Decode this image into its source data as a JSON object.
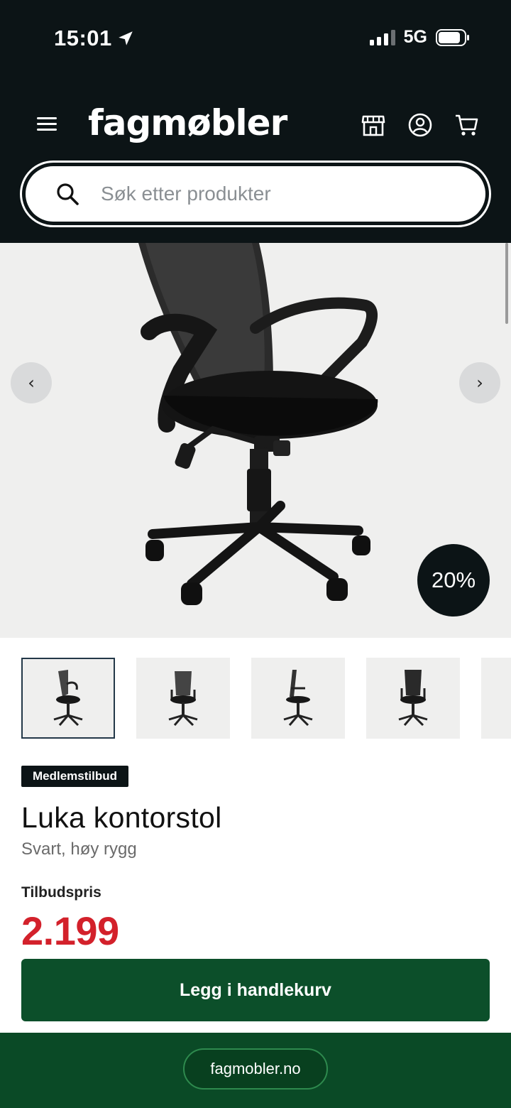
{
  "status_bar": {
    "time": "15:01",
    "network": "5G"
  },
  "header": {
    "logo": "fagmøbler",
    "icons": [
      "menu-icon",
      "store-icon",
      "account-icon",
      "cart-icon"
    ]
  },
  "search": {
    "placeholder": "Søk etter produkter"
  },
  "gallery": {
    "discount": "20%",
    "thumbnail_count": 5,
    "active_index": 0
  },
  "product": {
    "badge": "Medlemstilbud",
    "title": "Luka kontorstol",
    "subtitle": "Svart, høy rygg",
    "price_label": "Tilbudspris",
    "price": "2.199"
  },
  "actions": {
    "add_to_cart": "Legg i handlekurv"
  },
  "footer": {
    "url": "fagmobler.no"
  },
  "colors": {
    "header_bg": "#0c1416",
    "price": "#d3212b",
    "cta": "#0c4f2a",
    "footer": "#0a4a26"
  }
}
